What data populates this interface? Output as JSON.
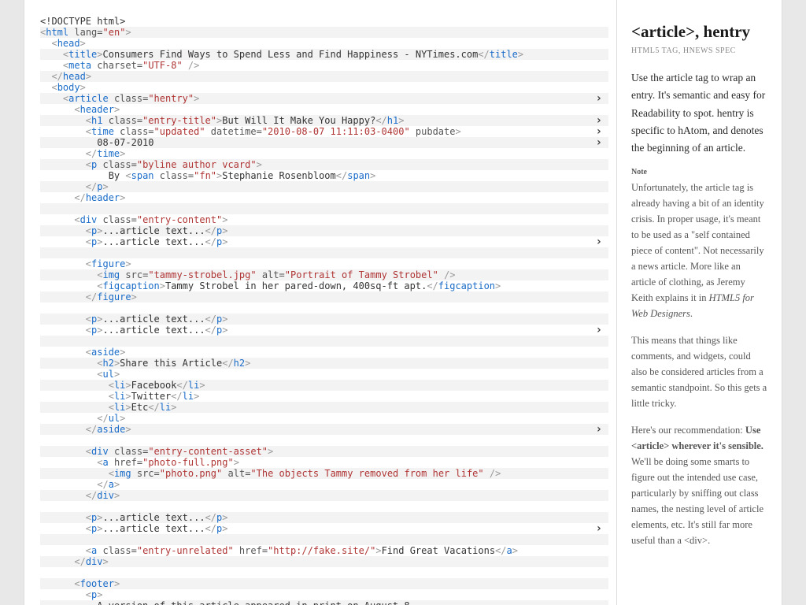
{
  "sidebar": {
    "title": "<article>, hentry",
    "meta": "HTML5 TAG, HNEWS SPEC",
    "intro": "Use the article tag to wrap an entry. It's semantic and easy for Readability to spot. hentry is specific to hAtom, and denotes the beginning of an article.",
    "note_label": "Note",
    "note1_a": "Unfortunately, the article tag is already having a bit of an identity crisis. In proper usage, it's meant to be used as a \"self contained piece of content\". Not necessarily a news article. More like an article of clothing, as Jeremy Keith explains it in ",
    "note1_em": "HTML5 for Web Designers",
    "note1_b": ".",
    "note2": "This means that things like comments, and widgets, could also be considered articles from a semantic standpoint. So this gets a little tricky.",
    "note3_a": "Here's our recommendation: ",
    "note3_bold": "Use <article> wherever it's sensible.",
    "note3_b": " We'll be doing some smarts to figure out the intended use case, particularly by sniffing out class names, the nesting level of article elements, etc. It's still far more useful than a <div>."
  },
  "code": {
    "doctype": "<!DOCTYPE html>",
    "html_open": "html",
    "lang_attr": "lang",
    "lang_val": "\"en\"",
    "head": "head",
    "title": "title",
    "title_text": "Consumers Find Ways to Spend Less and Find Happiness - NYTimes.com",
    "meta": "meta",
    "charset_attr": "charset",
    "charset_val": "\"UTF-8\"",
    "body": "body",
    "article": "article",
    "class_attr": "class",
    "hentry_val": "\"hentry\"",
    "header": "header",
    "h1": "h1",
    "entry_title_val": "\"entry-title\"",
    "h1_text": "But Will It Make You Happy?",
    "time": "time",
    "updated_val": "\"updated\"",
    "datetime_attr": "datetime",
    "datetime_val": "\"2010-08-07 11:11:03-0400\"",
    "pubdate": "pubdate",
    "date_text": "08-07-2010",
    "p": "p",
    "byline_val": "\"byline author vcard\"",
    "by_text": "By ",
    "span": "span",
    "fn_val": "\"fn\"",
    "author_name": "Stephanie Rosenbloom",
    "div": "div",
    "entry_content_val": "\"entry-content\"",
    "article_text": "...article text...",
    "figure": "figure",
    "img": "img",
    "src_attr": "src",
    "img1_src": "\"tammy-strobel.jpg\"",
    "alt_attr": "alt",
    "img1_alt": "\"Portrait of Tammy Strobel\"",
    "figcaption": "figcaption",
    "figcaption_text": "Tammy Strobel in her pared-down, 400sq-ft apt.",
    "aside": "aside",
    "h2": "h2",
    "h2_text": "Share this Article",
    "ul": "ul",
    "li": "li",
    "fb": "Facebook",
    "tw": "Twitter",
    "etc": "Etc",
    "asset_val": "\"entry-content-asset\"",
    "a": "a",
    "href_attr": "href",
    "photo_full": "\"photo-full.png\"",
    "photo_src": "\"photo.png\"",
    "photo_alt": "\"The objects Tammy removed from her life\"",
    "unrelated_val": "\"entry-unrelated\"",
    "fake_url": "\"http://fake.site/\"",
    "vacations_text": "Find Great Vacations",
    "footer": "footer",
    "footer_text": "A version of this article appeared in print on August 8"
  }
}
